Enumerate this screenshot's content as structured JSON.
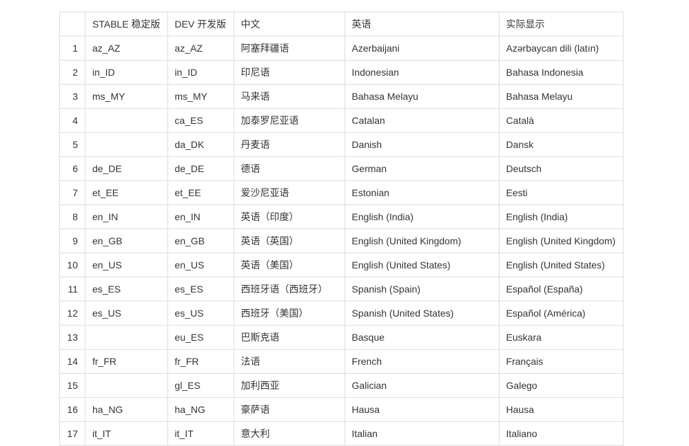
{
  "table": {
    "headers": [
      "",
      "STABLE 稳定版",
      "DEV 开发版",
      "中文",
      "英语",
      "实际显示"
    ],
    "rows": [
      [
        "1",
        "az_AZ",
        "az_AZ",
        "阿塞拜疆语",
        "Azerbaijani",
        "Azərbaycan dili (latın)"
      ],
      [
        "2",
        "in_ID",
        "in_ID",
        "印尼语",
        "Indonesian",
        "Bahasa Indonesia"
      ],
      [
        "3",
        "ms_MY",
        "ms_MY",
        "马来语",
        "Bahasa Melayu",
        "Bahasa Melayu"
      ],
      [
        "4",
        "",
        "ca_ES",
        "加泰罗尼亚语",
        "Catalan",
        "Català"
      ],
      [
        "5",
        "",
        "da_DK",
        "丹麦语",
        "Danish",
        "Dansk"
      ],
      [
        "6",
        "de_DE",
        "de_DE",
        "德语",
        "German",
        "Deutsch"
      ],
      [
        "7",
        "et_EE",
        "et_EE",
        "爱沙尼亚语",
        "Estonian",
        "Eesti"
      ],
      [
        "8",
        "en_IN",
        "en_IN",
        "英语（印度）",
        "English (India)",
        "English (India)"
      ],
      [
        "9",
        "en_GB",
        "en_GB",
        "英语（英国）",
        "English (United Kingdom)",
        "English (United Kingdom)"
      ],
      [
        "10",
        "en_US",
        "en_US",
        "英语（美国）",
        "English (United States)",
        "English (United States)"
      ],
      [
        "11",
        "es_ES",
        "es_ES",
        "西班牙语（西班牙）",
        "Spanish (Spain)",
        "Español (España)"
      ],
      [
        "12",
        "es_US",
        "es_US",
        "西班牙（美国）",
        "Spanish (United States)",
        "Español (América)"
      ],
      [
        "13",
        "",
        "eu_ES",
        "巴斯克语",
        "Basque",
        "Euskara"
      ],
      [
        "14",
        "fr_FR",
        "fr_FR",
        "法语",
        "French",
        "Français"
      ],
      [
        "15",
        "",
        "gl_ES",
        "加利西亚",
        "Galician",
        "Galego"
      ],
      [
        "16",
        "ha_NG",
        "ha_NG",
        "豪萨语",
        "Hausa",
        "Hausa"
      ],
      [
        "17",
        "it_IT",
        "it_IT",
        "意大利",
        "Italian",
        "Italiano"
      ]
    ]
  }
}
